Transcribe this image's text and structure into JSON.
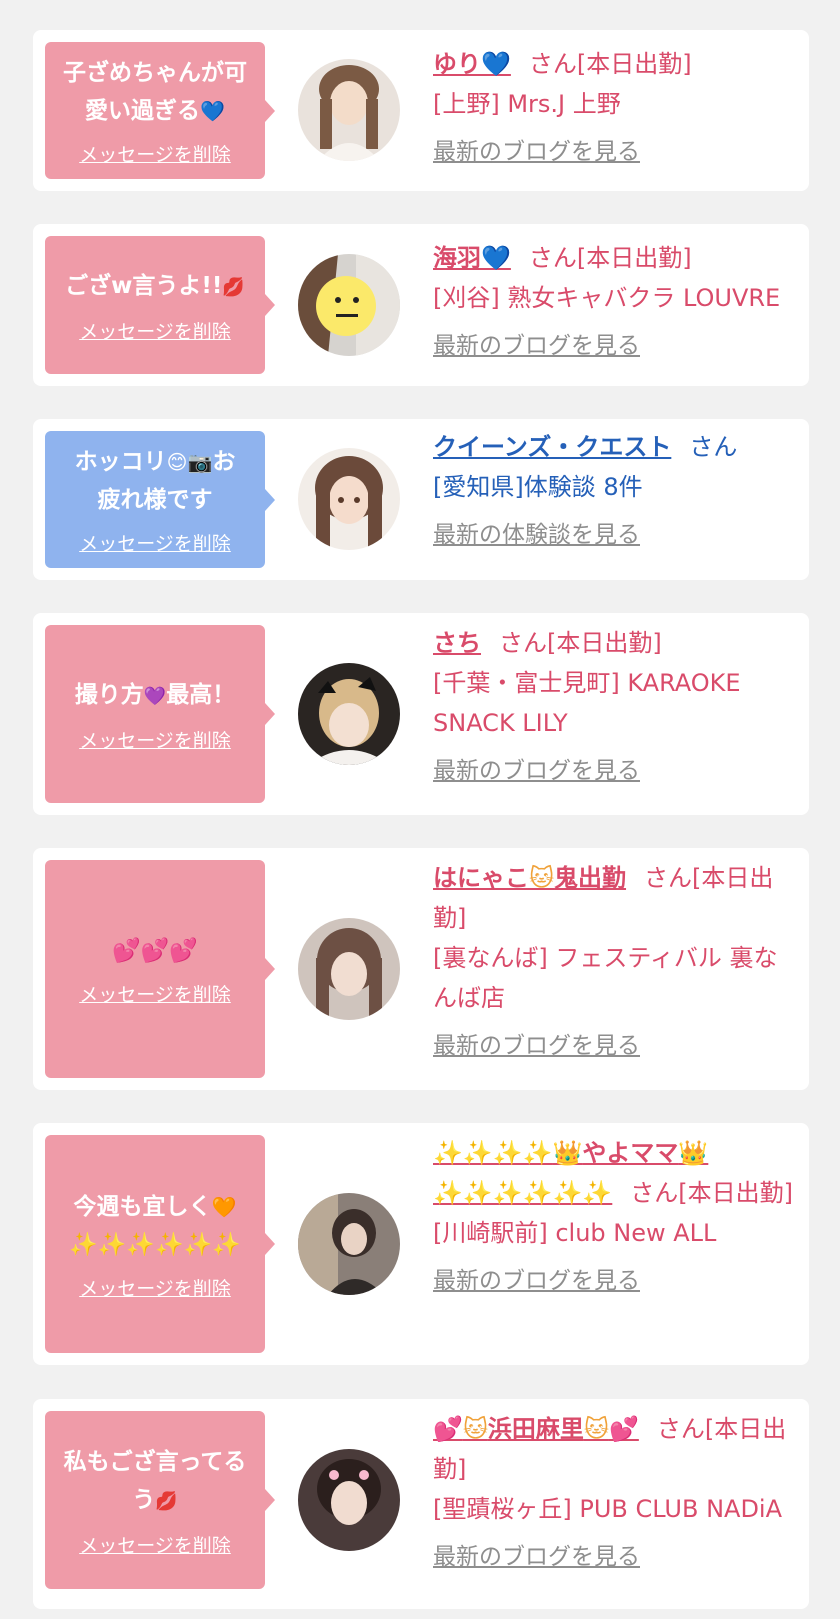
{
  "colors": {
    "background": "#f1f1f1",
    "card": "#ffffff",
    "bubble_pink": "#ef9ba8",
    "bubble_blue": "#8fb3ee",
    "accent_pink": "#d94b6a",
    "accent_blue": "#2560b8",
    "link_gray": "#8e8e8e"
  },
  "delete_label": "メッセージを削除",
  "san": "さん",
  "items": [
    {
      "bubble_lines": [
        "子ざめちゃんが可",
        "愛い過ぎる"
      ],
      "name": "ゆり",
      "status": "[本日出勤]",
      "shop": "[上野] Mrs.J 上野",
      "link": "最新のブログを見る"
    },
    {
      "bubble_lines": [
        "ござw言うよ!!"
      ],
      "name": "海羽",
      "status": "[本日出勤]",
      "shop": "[刈谷] 熟女キャバクラ LOUVRE",
      "link": "最新のブログを見る"
    },
    {
      "bubble_lines": [
        "ホッコリ",
        "お",
        "疲れ様です"
      ],
      "name": "クイーンズ・クエスト",
      "status": "",
      "shop": "[愛知県]体験談 8件",
      "link": "最新の体験談を見る"
    },
    {
      "bubble_lines": [
        "撮り方",
        "最高！"
      ],
      "name": "さち",
      "status": "[本日出勤]",
      "shop": "[千葉・富士見町] KARAOKE SNACK LILY",
      "link": "最新のブログを見る"
    },
    {
      "bubble_lines": [],
      "name_a": "はにゃこ",
      "name_b": "鬼出勤",
      "status": "[本日出勤]",
      "shop": "[裏なんば] フェスティバル 裏なんば店",
      "link": "最新のブログを見る"
    },
    {
      "bubble_lines": [
        "今週も宜しく"
      ],
      "name": "やよママ",
      "status": "[本日出勤]",
      "shop": "[川崎駅前] club New ALL",
      "link": "最新のブログを見る"
    },
    {
      "bubble_lines": [
        "私もござ言ってる",
        "う"
      ],
      "name": "浜田麻里",
      "status": "[本日出勤]",
      "shop": "[聖蹟桜ヶ丘] PUB CLUB NADiA",
      "link": "最新のブログを見る"
    }
  ]
}
